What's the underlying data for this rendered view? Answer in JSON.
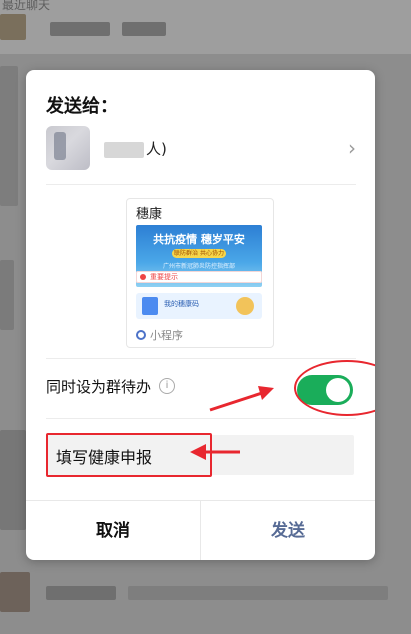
{
  "background": {
    "top_text": "最近聊天"
  },
  "dialog": {
    "title": "发送给：",
    "recipient": {
      "name": "人)"
    },
    "card": {
      "title": "穗康",
      "banner": {
        "headline": "共抗疫情 穗岁平安",
        "pill": "联防群治 共心协力",
        "sub": "广州市新冠肺炎防控指挥部"
      },
      "alert_text": "重要提示",
      "mini_text": "我的穗康码",
      "footer_label": "小程序"
    },
    "group_todo": {
      "label": "同时设为群待办",
      "info_icon": "i",
      "enabled": true
    },
    "input": {
      "value": "填写健康申报"
    },
    "buttons": {
      "cancel": "取消",
      "send": "发送"
    }
  },
  "colors": {
    "toggle_on": "#1aad5a",
    "send_text": "#576b95",
    "annotation_red": "#e8272f"
  }
}
